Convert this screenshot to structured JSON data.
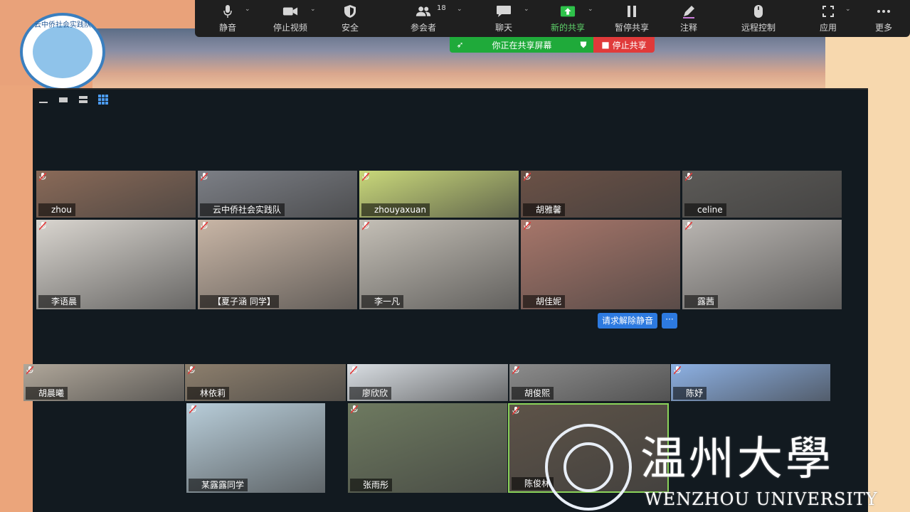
{
  "toolbar": {
    "mute": "静音",
    "stop_video": "停止视频",
    "security": "安全",
    "participants": "参会者",
    "participants_count": "18",
    "chat": "聊天",
    "new_share": "新的共享",
    "pause_share": "暂停共享",
    "annotate": "注释",
    "remote_control": "远程控制",
    "apps": "应用",
    "more": "更多"
  },
  "share_banner": {
    "status": "你正在共享屏幕",
    "stop": "停止共享"
  },
  "club_logo_text": "云中侨社会实践队",
  "participants": [
    {
      "name": "zhou",
      "color": "#8a6a58"
    },
    {
      "name": "云中侨社会实践队",
      "color": "#7c7f86"
    },
    {
      "name": "zhouyaxuan",
      "color": "#c9d87a"
    },
    {
      "name": "胡雅馨",
      "color": "#6b5146"
    },
    {
      "name": "celine",
      "color": "#5c5a57"
    },
    {
      "name": "李语晨",
      "color": "#d9d5cf"
    },
    {
      "name": "【夏子涵 同学】",
      "color": "#c9b6a6"
    },
    {
      "name": "李一凡",
      "color": "#c4bfb6"
    },
    {
      "name": "胡佳妮",
      "color": "#a7766a"
    },
    {
      "name": "露茜",
      "color": "#b9b5b1"
    },
    {
      "name": "胡晨曦",
      "color": "#b0a79a"
    },
    {
      "name": "林依莉",
      "color": "#8d7f6d"
    },
    {
      "name": "廖欣欣",
      "color": "#d9dee3"
    },
    {
      "name": "胡俊熙",
      "color": "#8c8c8c"
    },
    {
      "name": "陈妤",
      "color": "#8db1e4"
    },
    {
      "name": "某露露同学",
      "color": "#b8cdd9"
    },
    {
      "name": "张雨彤",
      "color": "#6e7a60"
    },
    {
      "name": "陈俊林",
      "color": "#5d5348"
    }
  ],
  "unmute_request": "请求解除静音",
  "more_options": "···",
  "university": {
    "name_cn": "温州大學",
    "name_en": "WENZHOU UNIVERSITY"
  }
}
